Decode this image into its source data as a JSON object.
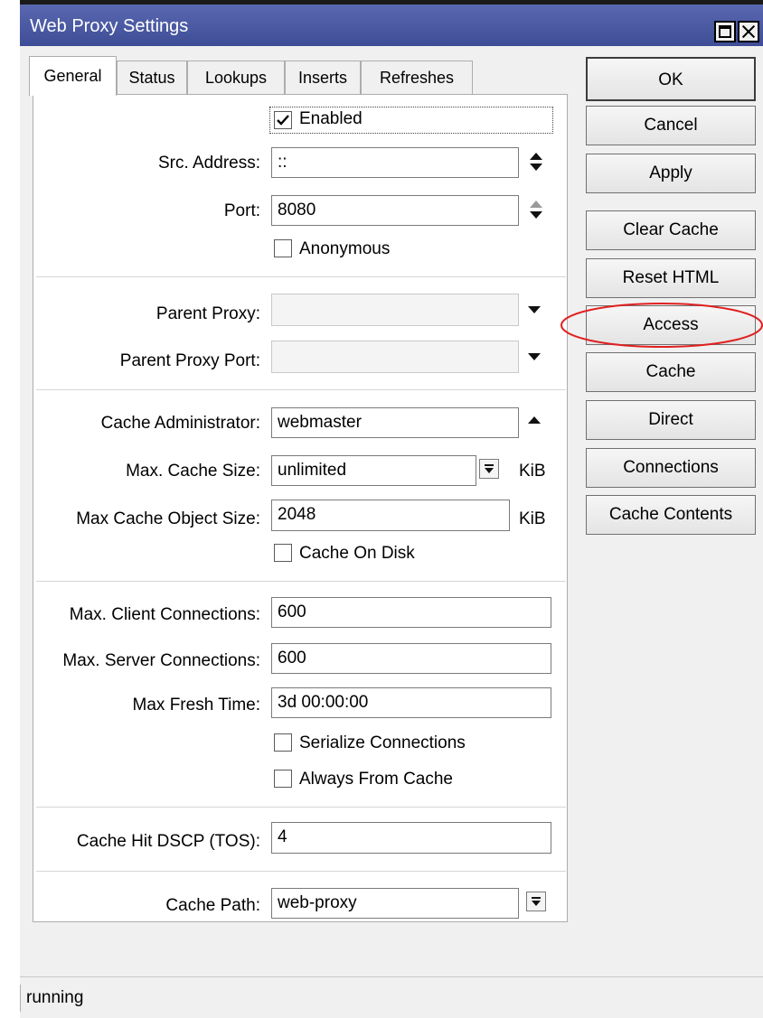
{
  "window": {
    "title": "Web Proxy Settings"
  },
  "tabs": [
    "General",
    "Status",
    "Lookups",
    "Inserts",
    "Refreshes"
  ],
  "form": {
    "enabled": {
      "label": "Enabled",
      "checked": true
    },
    "src_address": {
      "label": "Src. Address:",
      "value": "::"
    },
    "port": {
      "label": "Port:",
      "value": "8080"
    },
    "anonymous": {
      "label": "Anonymous",
      "checked": false
    },
    "parent_proxy": {
      "label": "Parent Proxy:",
      "value": ""
    },
    "parent_proxy_port": {
      "label": "Parent Proxy Port:",
      "value": ""
    },
    "cache_administrator": {
      "label": "Cache Administrator:",
      "value": "webmaster"
    },
    "max_cache_size": {
      "label": "Max. Cache Size:",
      "value": "unlimited",
      "unit": "KiB"
    },
    "max_cache_object_size": {
      "label": "Max Cache Object Size:",
      "value": "2048",
      "unit": "KiB"
    },
    "cache_on_disk": {
      "label": "Cache On Disk",
      "checked": false
    },
    "max_client_connections": {
      "label": "Max. Client Connections:",
      "value": "600"
    },
    "max_server_connections": {
      "label": "Max. Server Connections:",
      "value": "600"
    },
    "max_fresh_time": {
      "label": "Max Fresh Time:",
      "value": "3d 00:00:00"
    },
    "serialize_connections": {
      "label": "Serialize Connections",
      "checked": false
    },
    "always_from_cache": {
      "label": "Always From Cache",
      "checked": false
    },
    "cache_hit_dscp": {
      "label": "Cache Hit DSCP (TOS):",
      "value": "4"
    },
    "cache_path": {
      "label": "Cache Path:",
      "value": "web-proxy"
    }
  },
  "buttons": {
    "ok": "OK",
    "cancel": "Cancel",
    "apply": "Apply",
    "clear_cache": "Clear Cache",
    "reset_html": "Reset HTML",
    "access": "Access",
    "cache": "Cache",
    "direct": "Direct",
    "connections": "Connections",
    "cache_contents": "Cache Contents"
  },
  "status": "running",
  "colors": {
    "titlebar": "#4a58a3",
    "highlight": "#e02020"
  }
}
